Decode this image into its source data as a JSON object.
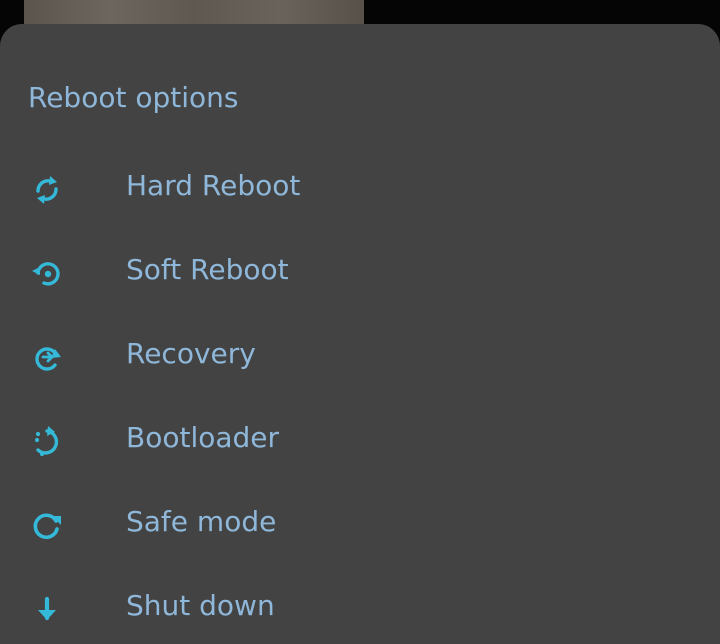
{
  "header": {
    "title": "Reboot options"
  },
  "menu": {
    "items": [
      {
        "label": "Hard Reboot",
        "icon": "sync-icon"
      },
      {
        "label": "Soft Reboot",
        "icon": "restart-alt-icon"
      },
      {
        "label": "Recovery",
        "icon": "refresh-arrow-icon"
      },
      {
        "label": "Bootloader",
        "icon": "dotted-restart-icon"
      },
      {
        "label": "Safe mode",
        "icon": "refresh-icon"
      },
      {
        "label": "Shut down",
        "icon": "arrow-down-icon"
      }
    ]
  },
  "colors": {
    "sheet_background": "#434343",
    "text": "#8fb7d9",
    "icon": "#35b9d8",
    "top_background": "#050505"
  }
}
